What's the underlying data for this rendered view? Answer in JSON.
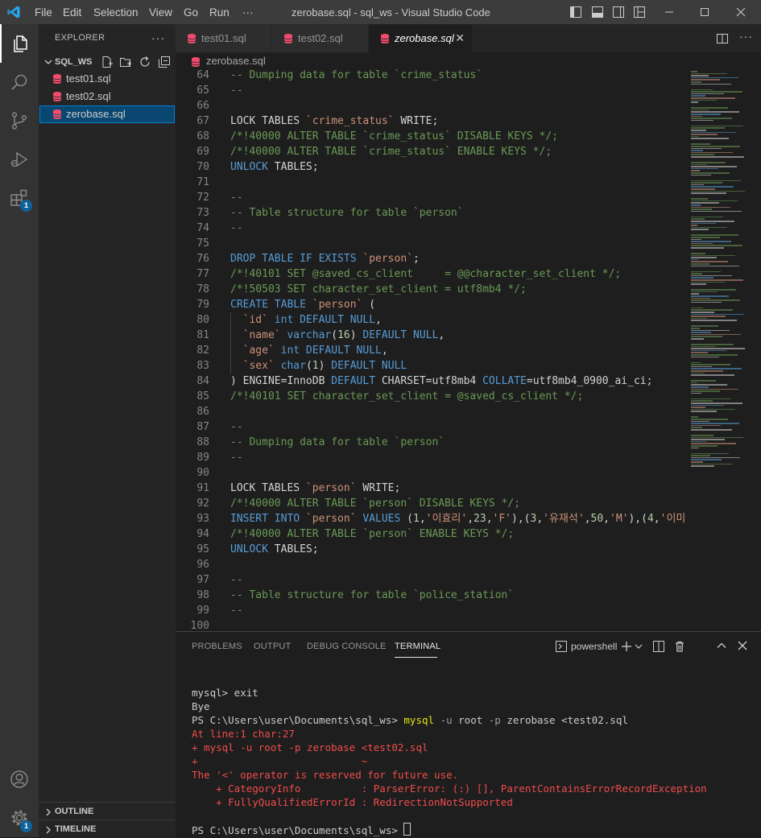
{
  "titlebar": {
    "menu": [
      "File",
      "Edit",
      "Selection",
      "View",
      "Go",
      "Run",
      "···"
    ],
    "window_title": "zerobase.sql - sql_ws - Visual Studio Code"
  },
  "activity": {
    "items": [
      "explorer",
      "search",
      "source-control",
      "run-debug",
      "extensions"
    ],
    "extensions_badge": "1",
    "settings_badge": "1"
  },
  "sidebar": {
    "header": "EXPLORER",
    "more": "···",
    "folder": "SQL_WS",
    "files": [
      "test01.sql",
      "test02.sql",
      "zerobase.sql"
    ],
    "selected_file": "zerobase.sql",
    "outline": "OUTLINE",
    "timeline": "TIMELINE"
  },
  "tabs": [
    "test01.sql",
    "test02.sql",
    "zerobase.sql"
  ],
  "active_tab": "zerobase.sql",
  "breadcrumb": "zerobase.sql",
  "editor_lines": [
    {
      "n": "64",
      "s": [
        [
          "c-com",
          "-- Dumping data for table `crime_status`"
        ]
      ]
    },
    {
      "n": "65",
      "s": [
        [
          "c-com",
          "--"
        ]
      ]
    },
    {
      "n": "66",
      "s": []
    },
    {
      "n": "67",
      "s": [
        [
          "c-plain",
          "LOCK TABLES "
        ],
        [
          "c-str",
          "`crime_status`"
        ],
        [
          "c-plain",
          " WRITE;"
        ]
      ]
    },
    {
      "n": "68",
      "s": [
        [
          "c-com",
          "/*!40000 ALTER TABLE `crime_status` DISABLE KEYS */;"
        ]
      ]
    },
    {
      "n": "69",
      "s": [
        [
          "c-com",
          "/*!40000 ALTER TABLE `crime_status` ENABLE KEYS */;"
        ]
      ]
    },
    {
      "n": "70",
      "s": [
        [
          "c-kw",
          "UNLOCK"
        ],
        [
          "c-plain",
          " TABLES;"
        ]
      ]
    },
    {
      "n": "71",
      "s": []
    },
    {
      "n": "72",
      "s": [
        [
          "c-com",
          "--"
        ]
      ]
    },
    {
      "n": "73",
      "s": [
        [
          "c-com",
          "-- Table structure for table `person`"
        ]
      ]
    },
    {
      "n": "74",
      "s": [
        [
          "c-com",
          "--"
        ]
      ]
    },
    {
      "n": "75",
      "s": []
    },
    {
      "n": "76",
      "s": [
        [
          "c-kw",
          "DROP TABLE IF EXISTS "
        ],
        [
          "c-str",
          "`person`"
        ],
        [
          "c-plain",
          ";"
        ]
      ]
    },
    {
      "n": "77",
      "s": [
        [
          "c-com",
          "/*!40101 SET @saved_cs_client     = @@character_set_client */;"
        ]
      ]
    },
    {
      "n": "78",
      "s": [
        [
          "c-com",
          "/*!50503 SET character_set_client = utf8mb4 */;"
        ]
      ]
    },
    {
      "n": "79",
      "s": [
        [
          "c-kw",
          "CREATE TABLE "
        ],
        [
          "c-str",
          "`person`"
        ],
        [
          "c-plain",
          " ("
        ]
      ]
    },
    {
      "n": "80",
      "s": [
        [
          "c-str",
          "  `id`"
        ],
        [
          "c-plain",
          " "
        ],
        [
          "c-kw",
          "int DEFAULT NULL"
        ],
        [
          "c-plain",
          ","
        ]
      ]
    },
    {
      "n": "81",
      "s": [
        [
          "c-str",
          "  `name`"
        ],
        [
          "c-plain",
          " "
        ],
        [
          "c-kw",
          "varchar"
        ],
        [
          "c-plain",
          "("
        ],
        [
          "c-num",
          "16"
        ],
        [
          "c-plain",
          ") "
        ],
        [
          "c-kw",
          "DEFAULT NULL"
        ],
        [
          "c-plain",
          ","
        ]
      ]
    },
    {
      "n": "82",
      "s": [
        [
          "c-str",
          "  `age`"
        ],
        [
          "c-plain",
          " "
        ],
        [
          "c-kw",
          "int DEFAULT NULL"
        ],
        [
          "c-plain",
          ","
        ]
      ]
    },
    {
      "n": "83",
      "s": [
        [
          "c-str",
          "  `sex`"
        ],
        [
          "c-plain",
          " "
        ],
        [
          "c-kw",
          "char"
        ],
        [
          "c-plain",
          "("
        ],
        [
          "c-num",
          "1"
        ],
        [
          "c-plain",
          ") "
        ],
        [
          "c-kw",
          "DEFAULT NULL"
        ]
      ]
    },
    {
      "n": "84",
      "s": [
        [
          "c-plain",
          ") ENGINE=InnoDB "
        ],
        [
          "c-kw",
          "DEFAULT"
        ],
        [
          "c-plain",
          " CHARSET=utf8mb4 "
        ],
        [
          "c-kw",
          "COLLATE"
        ],
        [
          "c-plain",
          "=utf8mb4_0900_ai_ci;"
        ]
      ]
    },
    {
      "n": "85",
      "s": [
        [
          "c-com",
          "/*!40101 SET character_set_client = @saved_cs_client */;"
        ]
      ]
    },
    {
      "n": "86",
      "s": []
    },
    {
      "n": "87",
      "s": [
        [
          "c-com",
          "--"
        ]
      ]
    },
    {
      "n": "88",
      "s": [
        [
          "c-com",
          "-- Dumping data for table `person`"
        ]
      ]
    },
    {
      "n": "89",
      "s": [
        [
          "c-com",
          "--"
        ]
      ]
    },
    {
      "n": "90",
      "s": []
    },
    {
      "n": "91",
      "s": [
        [
          "c-plain",
          "LOCK TABLES "
        ],
        [
          "c-str",
          "`person`"
        ],
        [
          "c-plain",
          " WRITE;"
        ]
      ]
    },
    {
      "n": "92",
      "s": [
        [
          "c-com",
          "/*!40000 ALTER TABLE `person` DISABLE KEYS */;"
        ]
      ]
    },
    {
      "n": "93",
      "s": [
        [
          "c-kw",
          "INSERT INTO "
        ],
        [
          "c-str",
          "`person`"
        ],
        [
          "c-plain",
          " "
        ],
        [
          "c-kw",
          "VALUES"
        ],
        [
          "c-plain",
          " ("
        ],
        [
          "c-num",
          "1"
        ],
        [
          "c-plain",
          ","
        ],
        [
          "c-str",
          "'이효리'"
        ],
        [
          "c-plain",
          ","
        ],
        [
          "c-num",
          "23"
        ],
        [
          "c-plain",
          ","
        ],
        [
          "c-str",
          "'F'"
        ],
        [
          "c-plain",
          "),("
        ],
        [
          "c-num",
          "3"
        ],
        [
          "c-plain",
          ","
        ],
        [
          "c-str",
          "'유재석'"
        ],
        [
          "c-plain",
          ","
        ],
        [
          "c-num",
          "50"
        ],
        [
          "c-plain",
          ","
        ],
        [
          "c-str",
          "'M'"
        ],
        [
          "c-plain",
          "),("
        ],
        [
          "c-num",
          "4"
        ],
        [
          "c-plain",
          ","
        ],
        [
          "c-str",
          "'이미"
        ]
      ]
    },
    {
      "n": "94",
      "s": [
        [
          "c-com",
          "/*!40000 ALTER TABLE `person` ENABLE KEYS */;"
        ]
      ]
    },
    {
      "n": "95",
      "s": [
        [
          "c-kw",
          "UNLOCK"
        ],
        [
          "c-plain",
          " TABLES;"
        ]
      ]
    },
    {
      "n": "96",
      "s": []
    },
    {
      "n": "97",
      "s": [
        [
          "c-com",
          "--"
        ]
      ]
    },
    {
      "n": "98",
      "s": [
        [
          "c-com",
          "-- Table structure for table `police_station`"
        ]
      ]
    },
    {
      "n": "99",
      "s": [
        [
          "c-com",
          "--"
        ]
      ]
    },
    {
      "n": "100",
      "s": []
    }
  ],
  "panel": {
    "tabs": [
      "PROBLEMS",
      "OUTPUT",
      "DEBUG CONSOLE",
      "TERMINAL"
    ],
    "active_tab": "TERMINAL",
    "shell": "powershell"
  },
  "terminal_lines": [
    {
      "cls": "",
      "s": [
        [
          "",
          "mysql> exit"
        ]
      ]
    },
    {
      "cls": "",
      "s": [
        [
          "",
          "Bye"
        ]
      ]
    },
    {
      "cls": "",
      "s": [
        [
          "",
          "PS C:\\Users\\user\\Documents\\sql_ws> "
        ],
        [
          "t-yel",
          "mysql"
        ],
        [
          "t-dim",
          " -u"
        ],
        [
          "",
          " root "
        ],
        [
          "t-dim",
          "-p"
        ],
        [
          "",
          " zerobase <test02.sql"
        ]
      ]
    },
    {
      "cls": "err",
      "s": [
        [
          "",
          "At line:1 char:27"
        ]
      ]
    },
    {
      "cls": "err",
      "s": [
        [
          "",
          "+ mysql -u root -p zerobase <test02.sql"
        ]
      ]
    },
    {
      "cls": "err",
      "s": [
        [
          "",
          "+                           ~"
        ]
      ]
    },
    {
      "cls": "err",
      "s": [
        [
          "",
          "The '<' operator is reserved for future use."
        ]
      ]
    },
    {
      "cls": "err",
      "s": [
        [
          "",
          "    + CategoryInfo          : ParserError: (:) [], ParentContainsErrorRecordException"
        ]
      ]
    },
    {
      "cls": "err",
      "s": [
        [
          "",
          "    + FullyQualifiedErrorId : RedirectionNotSupported"
        ]
      ]
    },
    {
      "cls": "",
      "s": [
        [
          "",
          ""
        ]
      ]
    },
    {
      "cls": "",
      "s": [
        [
          "",
          "PS C:\\Users\\user\\Documents\\sql_ws> "
        ]
      ]
    }
  ]
}
